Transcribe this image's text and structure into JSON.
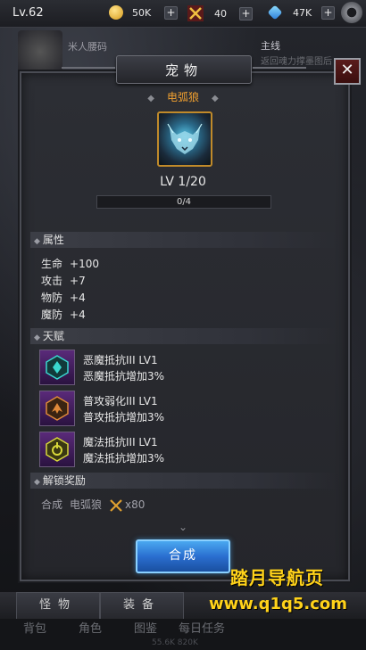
{
  "topbar": {
    "level": "Lv.62",
    "coins": "50K",
    "swords": "40",
    "gems": "47K",
    "plus": "+"
  },
  "background": {
    "task_left": "米人腰码",
    "task_right": "主线",
    "task_right_sub": "返回魂力撑墨图后"
  },
  "modal": {
    "title": "宠物",
    "close": "✕",
    "pet_name": "电弧狼",
    "pet_level": "LV 1/20",
    "xp_text": "0/4",
    "xp_progress": 0
  },
  "attributes": {
    "header": "属性",
    "items": [
      {
        "label": "生命",
        "value": "+100"
      },
      {
        "label": "攻击",
        "value": "+7"
      },
      {
        "label": "物防",
        "value": "+4"
      },
      {
        "label": "魔防",
        "value": "+4"
      }
    ]
  },
  "talents": {
    "header": "天赋",
    "items": [
      {
        "name": "恶魔抵抗III LV1",
        "desc": "恶魔抵抗增加3%",
        "color": "#3ad8d0"
      },
      {
        "name": "普攻弱化III LV1",
        "desc": "普攻抵抗增加3%",
        "color": "#e08a3a"
      },
      {
        "name": "魔法抵抗III LV1",
        "desc": "魔法抵抗增加3%",
        "color": "#d8d83a"
      }
    ]
  },
  "unlock": {
    "header": "解锁奖励",
    "compose": "合成",
    "target": "电弧狼",
    "cost": "x80"
  },
  "chevron": "⌄",
  "craft_button": "合成",
  "bottom_tabs": [
    "怪物",
    "装备"
  ],
  "bottom_nav": [
    "背包",
    "角色",
    "图鉴",
    "每日任务"
  ],
  "bottom_nums": "55.6K   820K",
  "watermark": {
    "line1": "踏月导航页",
    "line2": "www.q1q5.com"
  }
}
